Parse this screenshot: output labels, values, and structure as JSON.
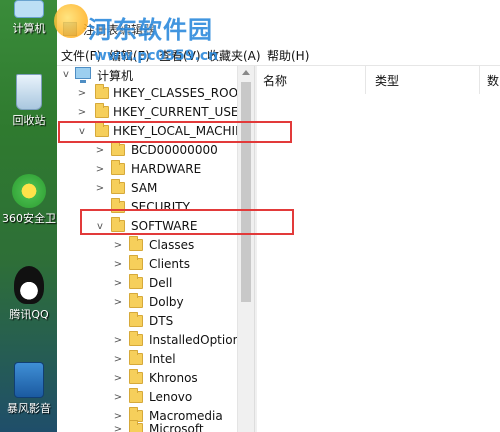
{
  "desktop": {
    "icons": [
      {
        "label": "计算机",
        "icon": "computer-icon"
      },
      {
        "label": "回收站",
        "icon": "recycle-bin-icon"
      },
      {
        "label": "360安全卫",
        "icon": "360-security-icon"
      },
      {
        "label": "腾讯QQ",
        "icon": "qq-penguin-icon"
      },
      {
        "label": "暴风影音",
        "icon": "storm-player-icon"
      }
    ]
  },
  "watermark": {
    "title": "河东软件园",
    "url": "www.pc0359.cn"
  },
  "window": {
    "title": "注册表编辑器",
    "menu": [
      "文件(F)",
      "编辑(E)",
      "查看(V)",
      "收藏夹(A)",
      "帮助(H)"
    ]
  },
  "right_pane": {
    "columns": [
      "名称",
      "类型",
      "数"
    ]
  },
  "tree": [
    {
      "label": "计算机",
      "expander": "v",
      "icon": "computer-icon"
    },
    {
      "label": "HKEY_CLASSES_ROOT",
      "expander": ">",
      "icon": "folder-icon"
    },
    {
      "label": "HKEY_CURRENT_USER",
      "expander": ">",
      "icon": "folder-icon"
    },
    {
      "label": "HKEY_LOCAL_MACHINE",
      "expander": "v",
      "icon": "folder-icon"
    },
    {
      "label": "BCD00000000",
      "expander": ">",
      "icon": "folder-icon"
    },
    {
      "label": "HARDWARE",
      "expander": ">",
      "icon": "folder-icon"
    },
    {
      "label": "SAM",
      "expander": ">",
      "icon": "folder-icon"
    },
    {
      "label": "SECURITY",
      "expander": "",
      "icon": "folder-icon"
    },
    {
      "label": "SOFTWARE",
      "expander": "v",
      "icon": "folder-icon"
    },
    {
      "label": "Classes",
      "expander": ">",
      "icon": "folder-icon"
    },
    {
      "label": "Clients",
      "expander": ">",
      "icon": "folder-icon"
    },
    {
      "label": "Dell",
      "expander": ">",
      "icon": "folder-icon"
    },
    {
      "label": "Dolby",
      "expander": ">",
      "icon": "folder-icon"
    },
    {
      "label": "DTS",
      "expander": "",
      "icon": "folder-icon"
    },
    {
      "label": "InstalledOptions",
      "expander": ">",
      "icon": "folder-icon"
    },
    {
      "label": "Intel",
      "expander": ">",
      "icon": "folder-icon"
    },
    {
      "label": "Khronos",
      "expander": ">",
      "icon": "folder-icon"
    },
    {
      "label": "Lenovo",
      "expander": ">",
      "icon": "folder-icon"
    },
    {
      "label": "Macromedia",
      "expander": ">",
      "icon": "folder-icon"
    },
    {
      "label": "Microsoft",
      "expander": ">",
      "icon": "folder-icon"
    }
  ],
  "highlight_color": "#e23a3a"
}
